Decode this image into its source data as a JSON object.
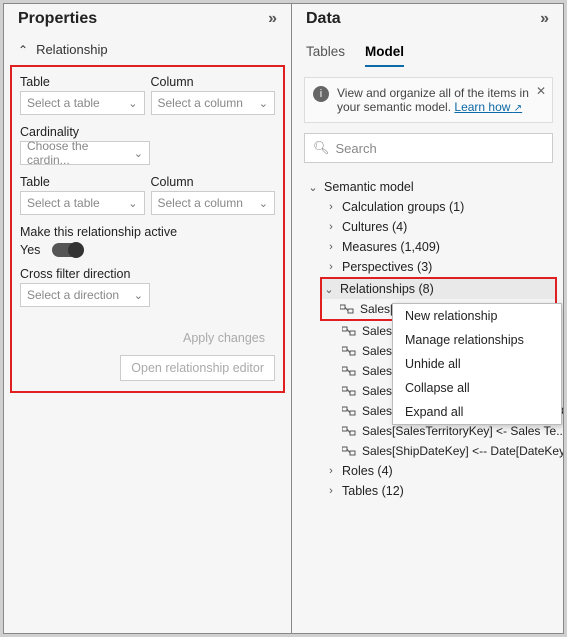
{
  "left": {
    "title": "Properties",
    "section": "Relationship",
    "table_lbl": "Table",
    "column_lbl": "Column",
    "table_ph": "Select a table",
    "column_ph": "Select a column",
    "cardinality_lbl": "Cardinality",
    "cardinality_ph": "Choose the cardin...",
    "active_lbl": "Make this relationship active",
    "active_val": "Yes",
    "cross_lbl": "Cross filter direction",
    "cross_ph": "Select a direction",
    "apply_btn": "Apply changes",
    "open_btn": "Open relationship editor"
  },
  "right": {
    "title": "Data",
    "tab_tables": "Tables",
    "tab_model": "Model",
    "info_text": "View and organize all of the items in your semantic model. ",
    "info_link": "Learn how",
    "search_ph": "Search",
    "root": "Semantic model",
    "nodes": {
      "calc": "Calculation groups (1)",
      "cultures": "Cultures (4)",
      "measures": "Measures (1,409)",
      "perspectives": "Perspectives (3)",
      "relationships": "Relationships (8)",
      "roles": "Roles (4)",
      "tables": "Tables (12)"
    },
    "rel_items": [
      "Sales[C",
      "Sales[D",
      "Sales[C",
      "Sales[P",
      "Sales[P",
      "Sales[SalesOrderLineKey] — Sales Or...",
      "Sales[SalesTerritoryKey] <- Sales Te...",
      "Sales[ShipDateKey] <-- Date[DateKey]"
    ],
    "ctx": {
      "new_rel": "New relationship",
      "manage": "Manage relationships",
      "unhide": "Unhide all",
      "collapse": "Collapse all",
      "expand": "Expand all"
    }
  }
}
